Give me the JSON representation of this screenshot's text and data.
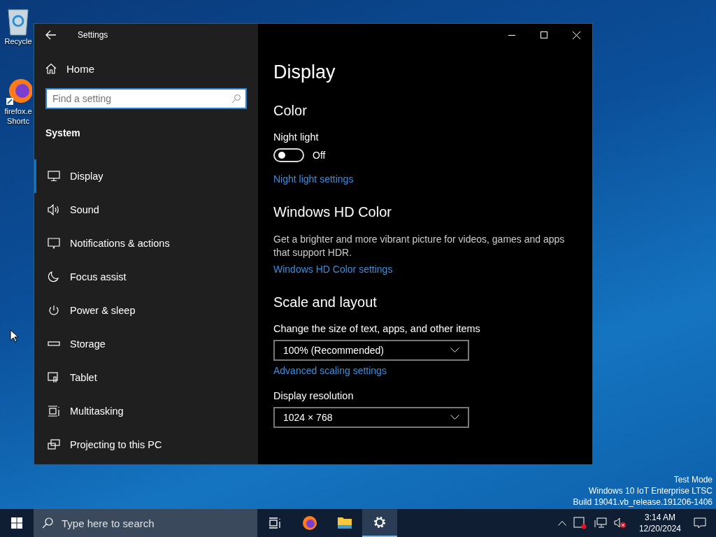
{
  "desktop": {
    "icons": [
      {
        "kind": "bin",
        "lines": [
          "Recycle"
        ]
      },
      {
        "kind": "firefox-shortcut",
        "lines": [
          "firefox.e",
          "Shortc"
        ]
      }
    ],
    "notice": [
      "Test Mode",
      "Windows 10 IoT Enterprise LTSC",
      "Build 19041.vb_release.191206-1406"
    ]
  },
  "window": {
    "title": "Settings",
    "sidebar": {
      "home": "Home",
      "search": {
        "placeholder": "Find a setting"
      },
      "section": "System",
      "items": [
        {
          "label": "Display",
          "kind": "monitor",
          "selected": true
        },
        {
          "label": "Sound",
          "kind": "speaker",
          "selected": false
        },
        {
          "label": "Notifications & actions",
          "kind": "message",
          "selected": false
        },
        {
          "label": "Focus assist",
          "kind": "moon",
          "selected": false
        },
        {
          "label": "Power & sleep",
          "kind": "power",
          "selected": false
        },
        {
          "label": "Storage",
          "kind": "drive",
          "selected": false
        },
        {
          "label": "Tablet",
          "kind": "tablet",
          "selected": false
        },
        {
          "label": "Multitasking",
          "kind": "multitask",
          "selected": false
        },
        {
          "label": "Projecting to this PC",
          "kind": "project",
          "selected": false
        }
      ]
    },
    "page_title": "Display",
    "sections": [
      {
        "heading": "Color",
        "blocks": [
          {
            "kind": "label",
            "text": "Night light"
          },
          {
            "kind": "toggle",
            "on": false,
            "text": "Off"
          },
          {
            "kind": "link",
            "text": "Night light settings"
          }
        ]
      },
      {
        "heading": "Windows HD Color",
        "blocks": [
          {
            "kind": "text",
            "text": "Get a brighter and more vibrant picture for videos, games and apps that support HDR."
          },
          {
            "kind": "link",
            "text": "Windows HD Color settings"
          }
        ]
      },
      {
        "heading": "Scale and layout",
        "blocks": [
          {
            "kind": "label",
            "text": "Change the size of text, apps, and other items"
          },
          {
            "kind": "dropdown",
            "text": "100% (Recommended)"
          },
          {
            "kind": "link",
            "text": "Advanced scaling settings"
          },
          {
            "kind": "label",
            "text": "Display resolution"
          },
          {
            "kind": "dropdown",
            "text": "1024 × 768"
          }
        ]
      }
    ]
  },
  "taskbar": {
    "search": {
      "placeholder": "Type here to search"
    },
    "apps": [
      {
        "kind": "taskview",
        "selected": false
      },
      {
        "kind": "firefox",
        "selected": false
      },
      {
        "kind": "folder",
        "selected": false
      },
      {
        "kind": "gear",
        "selected": true
      }
    ],
    "time": "3:14 AM",
    "date": "12/20/2024"
  }
}
